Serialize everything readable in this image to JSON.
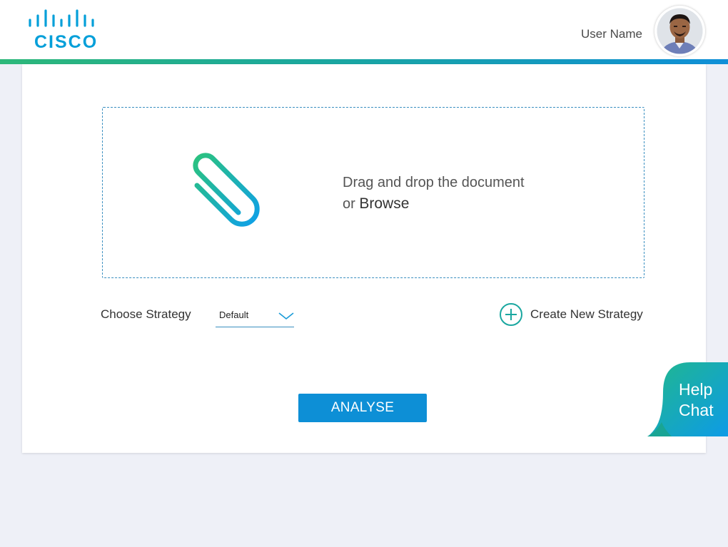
{
  "header": {
    "logo_text": "CISCO",
    "user_name": "User Name",
    "accent_gradient": [
      "#2db87a",
      "#0f8fd8"
    ]
  },
  "upload": {
    "line1": "Drag and drop the document",
    "line2_prefix": "or",
    "browse_label": "Browse",
    "icon": "paperclip-icon"
  },
  "strategy": {
    "label": "Choose Strategy",
    "selected": "Default",
    "create_label": "Create New Strategy"
  },
  "actions": {
    "analyse_label": "ANALYSE"
  },
  "help": {
    "line1": "Help",
    "line2": "Chat"
  },
  "colors": {
    "primary": "#0d8fd6",
    "accent_teal": "#1aa7a0",
    "background": "#eef0f7"
  }
}
